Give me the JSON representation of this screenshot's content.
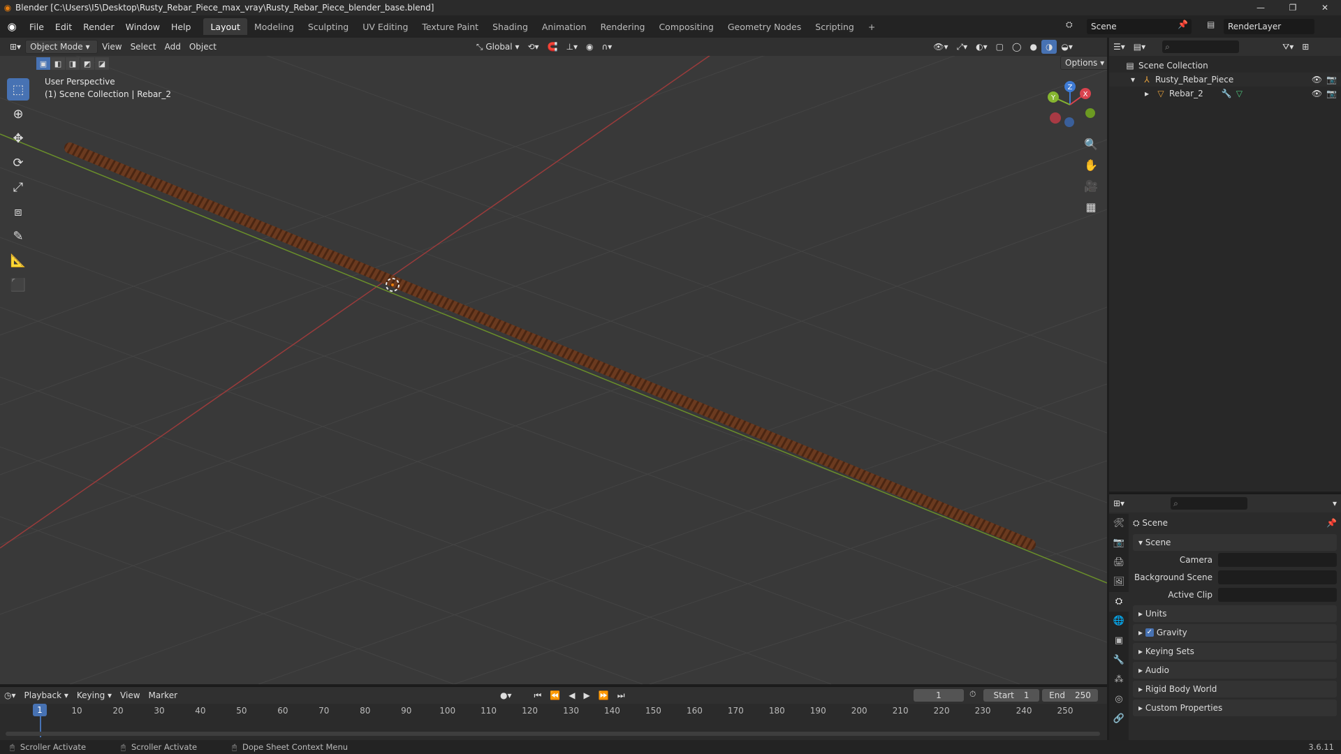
{
  "window": {
    "title": "Blender [C:\\Users\\I5\\Desktop\\Rusty_Rebar_Piece_max_vray\\Rusty_Rebar_Piece_blender_base.blend]",
    "minimize": "—",
    "maximize": "❐",
    "close": "✕"
  },
  "menu": [
    "File",
    "Edit",
    "Render",
    "Window",
    "Help"
  ],
  "workspaces": [
    "Layout",
    "Modeling",
    "Sculpting",
    "UV Editing",
    "Texture Paint",
    "Shading",
    "Animation",
    "Rendering",
    "Compositing",
    "Geometry Nodes",
    "Scripting"
  ],
  "active_workspace": "Layout",
  "scene_name": "Scene",
  "render_layer": "RenderLayer",
  "viewport_header": {
    "mode": "Object Mode",
    "view": "View",
    "select": "Select",
    "add": "Add",
    "object": "Object",
    "transform_orientation": "Global",
    "options": "Options"
  },
  "viewport": {
    "perspective": "User Perspective",
    "collection_info": "(1) Scene Collection | Rebar_2",
    "gizmo_axes": [
      "X",
      "Y",
      "Z"
    ]
  },
  "outliner": {
    "root": "Scene Collection",
    "items": [
      {
        "name": "Rusty_Rebar_Piece",
        "icon": "empty-icon"
      },
      {
        "name": "Rebar_2",
        "icon": "mesh-icon"
      }
    ]
  },
  "properties": {
    "context": "Scene",
    "panel": "Scene",
    "fields": [
      {
        "label": "Camera",
        "value": ""
      },
      {
        "label": "Background Scene",
        "value": ""
      },
      {
        "label": "Active Clip",
        "value": ""
      }
    ],
    "sections": [
      "Units",
      "Gravity",
      "Keying Sets",
      "Audio",
      "Rigid Body World",
      "Custom Properties"
    ],
    "gravity_checked": true
  },
  "timeline": {
    "playback": "Playback",
    "keying": "Keying",
    "view": "View",
    "marker": "Marker",
    "current_frame": "1",
    "start_label": "Start",
    "start": "1",
    "end_label": "End",
    "end": "250",
    "ruler": [
      "1",
      "10",
      "20",
      "30",
      "40",
      "50",
      "60",
      "70",
      "80",
      "90",
      "100",
      "110",
      "120",
      "130",
      "140",
      "150",
      "160",
      "170",
      "180",
      "190",
      "200",
      "210",
      "220",
      "230",
      "240",
      "250"
    ]
  },
  "status": {
    "items": [
      "Scroller Activate",
      "Scroller Activate",
      "Dope Sheet Context Menu"
    ],
    "version": "3.6.11"
  },
  "colors": {
    "accent": "#4772b3",
    "x_axis": "#c0392b",
    "y_axis": "#7aa32d",
    "rebar": "#6b3a1f"
  }
}
